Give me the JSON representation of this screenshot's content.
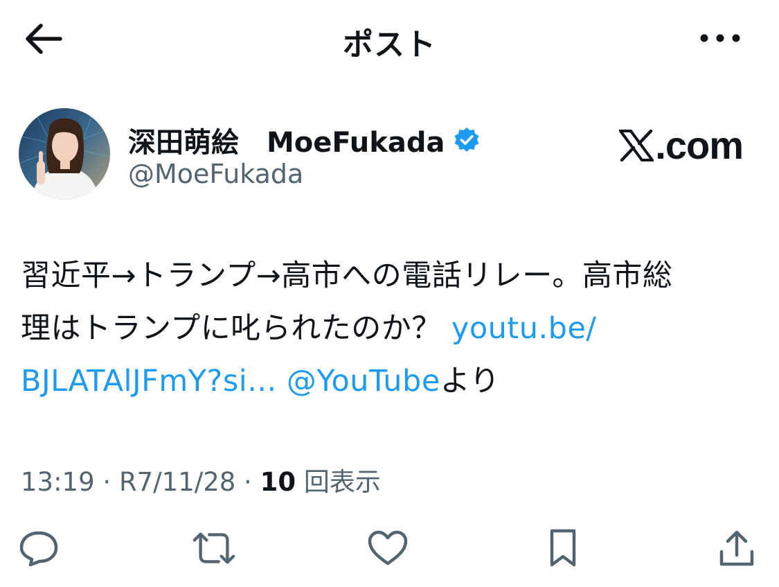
{
  "header": {
    "title": "ポスト",
    "back_icon": "arrow-left-icon",
    "more_icon": "more-horizontal-icon"
  },
  "author": {
    "name": "深田萌絵　MoeFukada",
    "handle": "@MoeFukada",
    "verified": true
  },
  "watermark": {
    "text": ".com"
  },
  "post": {
    "line1": "習近平→トランプ→高市への電話リレー。高市総",
    "line2_text": "理はトランプに叱られたのか？ ",
    "line2_link": "youtu.be/",
    "line3_link": "BJLATAlJFmY?si...",
    "line3_space": " ",
    "line3_mention": "@YouTube",
    "line3_tail": "より"
  },
  "meta": {
    "time": "13:19",
    "sep1": " · ",
    "date": "R7/11/28",
    "sep2": " · ",
    "views_count": "10",
    "views_label": " 回表示"
  },
  "actions": {
    "reply_icon": "reply-icon",
    "repost_icon": "repost-icon",
    "like_icon": "heart-icon",
    "bookmark_icon": "bookmark-icon",
    "share_icon": "share-icon"
  },
  "colors": {
    "link": "#1d9bf0",
    "text": "#0f1419",
    "muted": "#536471"
  }
}
